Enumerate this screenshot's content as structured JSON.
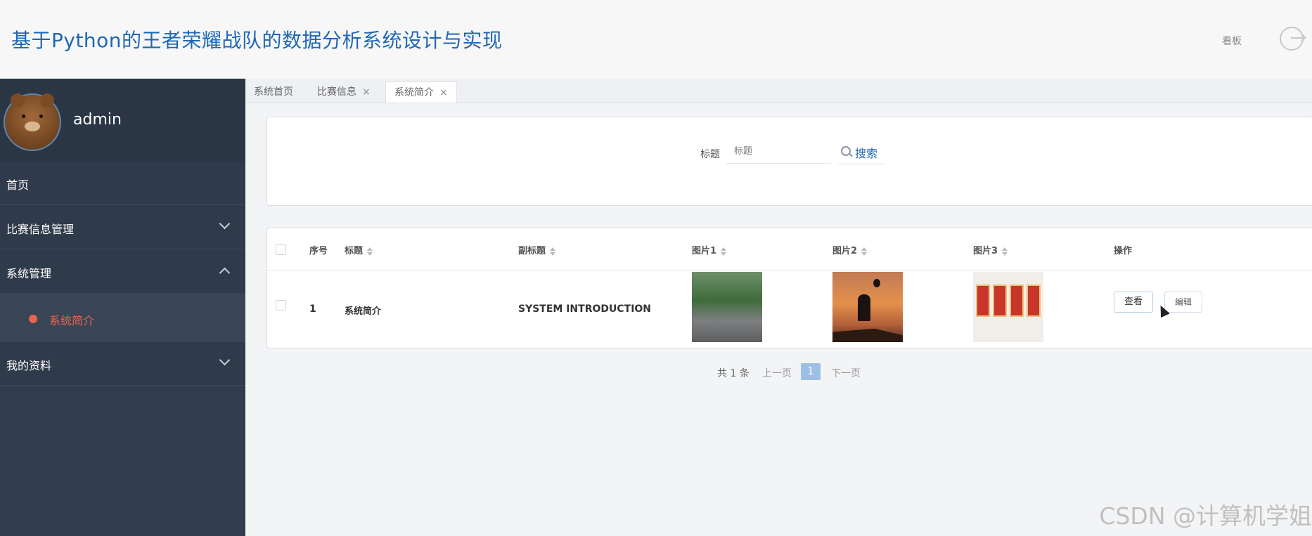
{
  "header": {
    "title": "基于Python的王者荣耀战队的数据分析系统设计与实现",
    "board_link": "看板"
  },
  "profile": {
    "username": "admin"
  },
  "sidebar": {
    "items": [
      {
        "label": "首页"
      },
      {
        "label": "比赛信息管理"
      },
      {
        "label": "系统管理"
      },
      {
        "label": "我的资料"
      }
    ],
    "submenu": {
      "label": "系统简介"
    }
  },
  "tabs": [
    {
      "label": "系统首页",
      "close": ""
    },
    {
      "label": "比赛信息",
      "close": "×"
    },
    {
      "label": "系统简介",
      "close": "×"
    }
  ],
  "search": {
    "label": "标题",
    "placeholder": "标题",
    "button": "搜索"
  },
  "table": {
    "headers": [
      "序号",
      "标题",
      "副标题",
      "图片1",
      "图片2",
      "图片3",
      "操作"
    ],
    "rows": [
      {
        "index": "1",
        "title": "系统简介",
        "subtitle": "SYSTEM INTRODUCTION",
        "actions": [
          "查看",
          "编辑"
        ]
      }
    ]
  },
  "pagination": {
    "total": "共 1 条",
    "prev": "上一页",
    "current": "1",
    "next": "下一页"
  },
  "watermark": "CSDN @计算机学姐",
  "colors": {
    "accent": "#1f67b4",
    "sidebar_bg": "#313c4c",
    "active_sub": "#e5654f"
  }
}
